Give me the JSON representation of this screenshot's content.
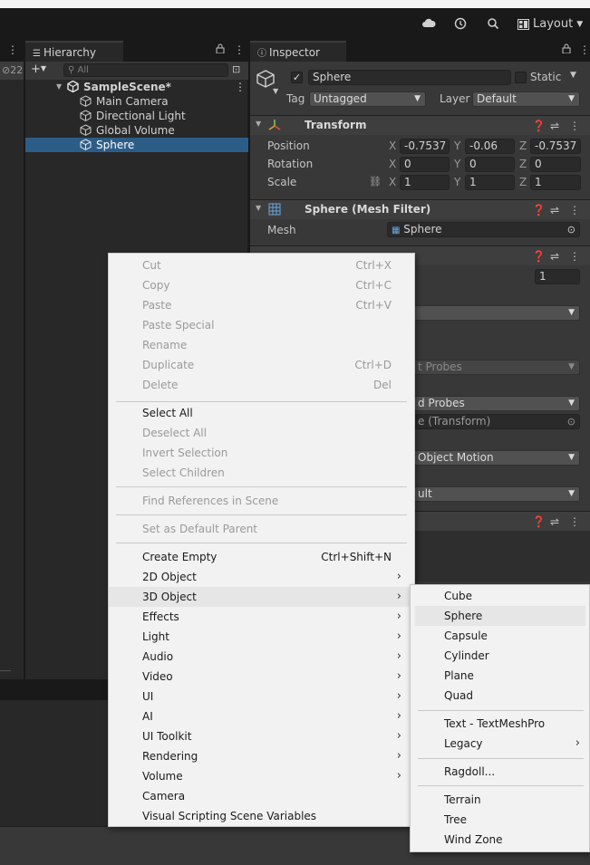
{
  "toolbar": {
    "cloud_icon": "cloud-icon",
    "history_icon": "history-icon",
    "search_icon": "search-icon",
    "layout_label": "Layout"
  },
  "left_panel": {
    "count": "22"
  },
  "hierarchy": {
    "tab_label": "Hierarchy",
    "search_placeholder": "All",
    "items": [
      {
        "label": "SampleScene*"
      },
      {
        "label": "Main Camera"
      },
      {
        "label": "Directional Light"
      },
      {
        "label": "Global Volume"
      },
      {
        "label": "Sphere"
      }
    ]
  },
  "inspector": {
    "tab_label": "Inspector",
    "object_name": "Sphere",
    "static_label": "Static",
    "tag_label": "Tag",
    "tag_value": "Untagged",
    "layer_label": "Layer",
    "layer_value": "Default",
    "transform": {
      "title": "Transform",
      "position_label": "Position",
      "rotation_label": "Rotation",
      "scale_label": "Scale",
      "x": "X",
      "y": "Y",
      "z": "Z",
      "position": [
        "-0.7537",
        "-0.06",
        "-0.7537"
      ],
      "rotation": [
        "0",
        "0",
        "0"
      ],
      "scale": [
        "1",
        "1",
        "1"
      ]
    },
    "mesh_filter": {
      "title": "Sphere (Mesh Filter)",
      "mesh_label": "Mesh",
      "mesh_value": "Sphere"
    },
    "renderer_partial": {
      "value_1": "1",
      "probes_1": "t Probes",
      "probes_2": "d Probes",
      "transform_ref": "e (Transform)",
      "motion": "Object Motion",
      "default": "ult"
    }
  },
  "context_menu": {
    "items": [
      {
        "label": "Cut",
        "shortcut": "Ctrl+X",
        "disabled": true
      },
      {
        "label": "Copy",
        "shortcut": "Ctrl+C",
        "disabled": true
      },
      {
        "label": "Paste",
        "shortcut": "Ctrl+V",
        "disabled": true
      },
      {
        "label": "Paste Special",
        "shortcut": "",
        "disabled": true
      },
      {
        "label": "Rename",
        "shortcut": "",
        "disabled": true
      },
      {
        "label": "Duplicate",
        "shortcut": "Ctrl+D",
        "disabled": true
      },
      {
        "label": "Delete",
        "shortcut": "Del",
        "disabled": true
      },
      {
        "label": "Select All",
        "shortcut": "",
        "disabled": false
      },
      {
        "label": "Deselect All",
        "shortcut": "",
        "disabled": true
      },
      {
        "label": "Invert Selection",
        "shortcut": "",
        "disabled": true
      },
      {
        "label": "Select Children",
        "shortcut": "",
        "disabled": true
      },
      {
        "label": "Find References in Scene",
        "shortcut": "",
        "disabled": true
      },
      {
        "label": "Set as Default Parent",
        "shortcut": "",
        "disabled": true
      },
      {
        "label": "Create Empty",
        "shortcut": "Ctrl+Shift+N",
        "disabled": false
      },
      {
        "label": "2D Object",
        "submenu": true
      },
      {
        "label": "3D Object",
        "submenu": true,
        "highlighted": true
      },
      {
        "label": "Effects",
        "submenu": true
      },
      {
        "label": "Light",
        "submenu": true
      },
      {
        "label": "Audio",
        "submenu": true
      },
      {
        "label": "Video",
        "submenu": true
      },
      {
        "label": "UI",
        "submenu": true
      },
      {
        "label": "AI",
        "submenu": true
      },
      {
        "label": "UI Toolkit",
        "submenu": true
      },
      {
        "label": "Rendering",
        "submenu": true
      },
      {
        "label": "Volume",
        "submenu": true
      },
      {
        "label": "Camera",
        "submenu": false
      },
      {
        "label": "Visual Scripting Scene Variables",
        "submenu": false
      }
    ]
  },
  "submenu_3d": {
    "items": [
      {
        "label": "Cube"
      },
      {
        "label": "Sphere",
        "highlighted": true
      },
      {
        "label": "Capsule"
      },
      {
        "label": "Cylinder"
      },
      {
        "label": "Plane"
      },
      {
        "label": "Quad"
      },
      {
        "label": "Text - TextMeshPro"
      },
      {
        "label": "Legacy",
        "submenu": true
      },
      {
        "label": "Ragdoll..."
      },
      {
        "label": "Terrain"
      },
      {
        "label": "Tree"
      },
      {
        "label": "Wind Zone"
      }
    ]
  },
  "colors": {
    "selection": "#2c5d87",
    "menu_bg": "#f2f2f2",
    "menu_highlight": "#e6e6e6",
    "transform_accent": "#e0a030"
  }
}
